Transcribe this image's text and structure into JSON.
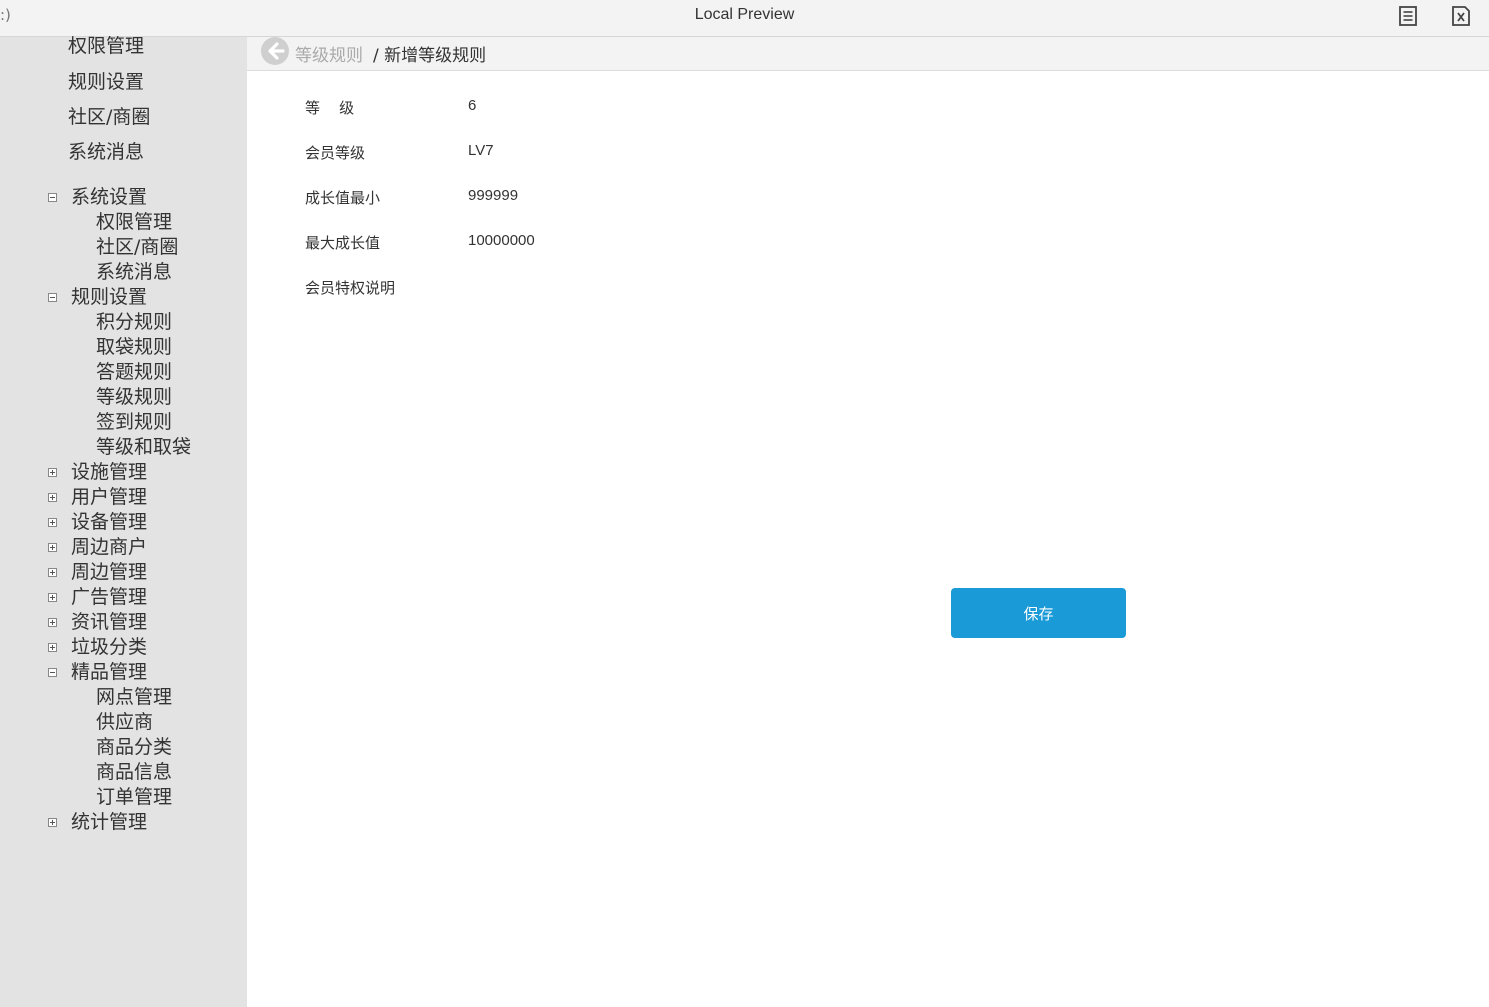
{
  "window": {
    "title": "Local Preview",
    "left_fragment": ":)"
  },
  "sidebar": {
    "top_items": [
      "权限管理",
      "规则设置",
      "社区/商圈",
      "系统消息"
    ],
    "tree": [
      {
        "label": "系统设置",
        "expanded": true,
        "children": [
          "权限管理",
          "社区/商圈",
          "系统消息"
        ]
      },
      {
        "label": "规则设置",
        "expanded": true,
        "children": [
          "积分规则",
          "取袋规则",
          "答题规则",
          "等级规则",
          "签到规则",
          "等级和取袋"
        ]
      },
      {
        "label": "设施管理",
        "expanded": false,
        "children": []
      },
      {
        "label": "用户管理",
        "expanded": false,
        "children": []
      },
      {
        "label": "设备管理",
        "expanded": false,
        "children": []
      },
      {
        "label": "周边商户",
        "expanded": false,
        "children": []
      },
      {
        "label": "周边管理",
        "expanded": false,
        "children": []
      },
      {
        "label": "广告管理",
        "expanded": false,
        "children": []
      },
      {
        "label": "资讯管理",
        "expanded": false,
        "children": []
      },
      {
        "label": "垃圾分类",
        "expanded": false,
        "children": []
      },
      {
        "label": "精品管理",
        "expanded": true,
        "children": [
          "网点管理",
          "供应商",
          "商品分类",
          "商品信息",
          "订单管理"
        ]
      },
      {
        "label": "统计管理",
        "expanded": false,
        "children": []
      }
    ]
  },
  "breadcrumb": {
    "parent": "等级规则",
    "current": "/ 新增等级规则"
  },
  "form": {
    "fields": [
      {
        "label": "等    级",
        "value": "6"
      },
      {
        "label": "会员等级",
        "value": "LV7"
      },
      {
        "label": "成长值最小",
        "value": "999999"
      },
      {
        "label": "最大成长值",
        "value": "10000000"
      },
      {
        "label": "会员特权说明",
        "value": ""
      }
    ],
    "save_label": "保存"
  },
  "colors": {
    "sidebar_bg": "#e3e3e3",
    "accent": "#1a9ad6"
  }
}
